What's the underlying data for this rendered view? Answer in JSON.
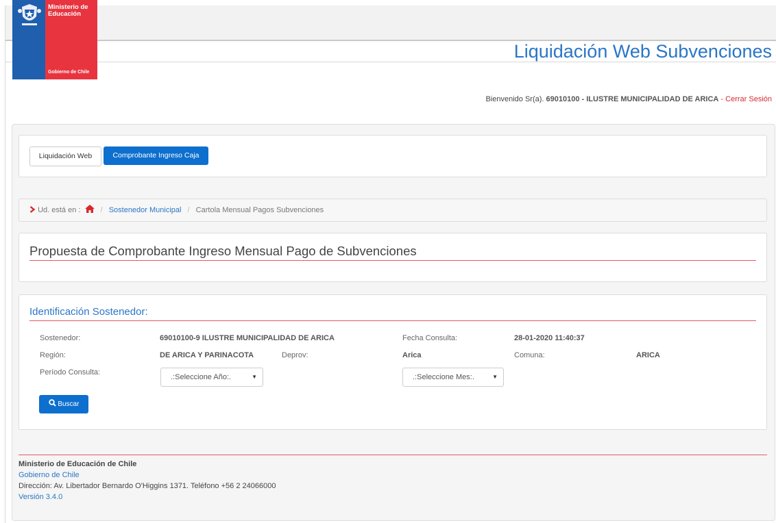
{
  "header": {
    "logo_line1": "Ministerio de",
    "logo_line2": "Educación",
    "logo_line3": "Gobierno de Chile",
    "app_title": "Liquidación Web Subvenciones"
  },
  "user": {
    "greeting": "Bienvenido Sr(a).",
    "name": "69010100 - ILUSTRE MUNICIPALIDAD DE ARICA",
    "logout": "- Cerrar Sesión"
  },
  "nav": {
    "btn_liquidacion": "Liquidación Web",
    "btn_comprobante": "Comprobante Ingreso Caja"
  },
  "breadcrumb": {
    "prefix": "Ud. está en :",
    "home_icon": "home-icon",
    "item1": "Sostenedor Municipal",
    "item2": "Cartola Mensual Pagos Subvenciones",
    "sep": "/"
  },
  "page": {
    "title": "Propuesta de Comprobante Ingreso Mensual Pago de Subvenciones"
  },
  "identificacion": {
    "title": "Identificación Sostenedor:",
    "sostenedor_label": "Sostenedor:",
    "sostenedor_value": "69010100-9 ILUSTRE MUNICIPALIDAD DE ARICA",
    "fecha_label": "Fecha Consulta:",
    "fecha_value": "28-01-2020 11:40:37",
    "region_label": "Región:",
    "region_value": "DE ARICA Y PARINACOTA",
    "deprov_label": "Deprov:",
    "deprov_value": "Arica",
    "comuna_label": "Comuna:",
    "comuna_value": "ARICA",
    "periodo_label": "Período Consulta:",
    "year_select": ".:Seleccione Año:.",
    "month_select": ".:Seleccione Mes:.",
    "search_button": "Buscar"
  },
  "footer": {
    "line1": "Ministerio de Educación de Chile",
    "line2": "Gobierno de Chile",
    "line3": "Dirección: Av. Libertador Bernardo O'Higgins 1371. Teléfono +56 2 24066000",
    "line4": "Versión 3.4.0"
  },
  "colors": {
    "primary": "#0d6fce",
    "accent_red": "#d9282f",
    "link": "#2a76c6",
    "logo_blue": "#1f5fae",
    "logo_red": "#e8343f"
  }
}
